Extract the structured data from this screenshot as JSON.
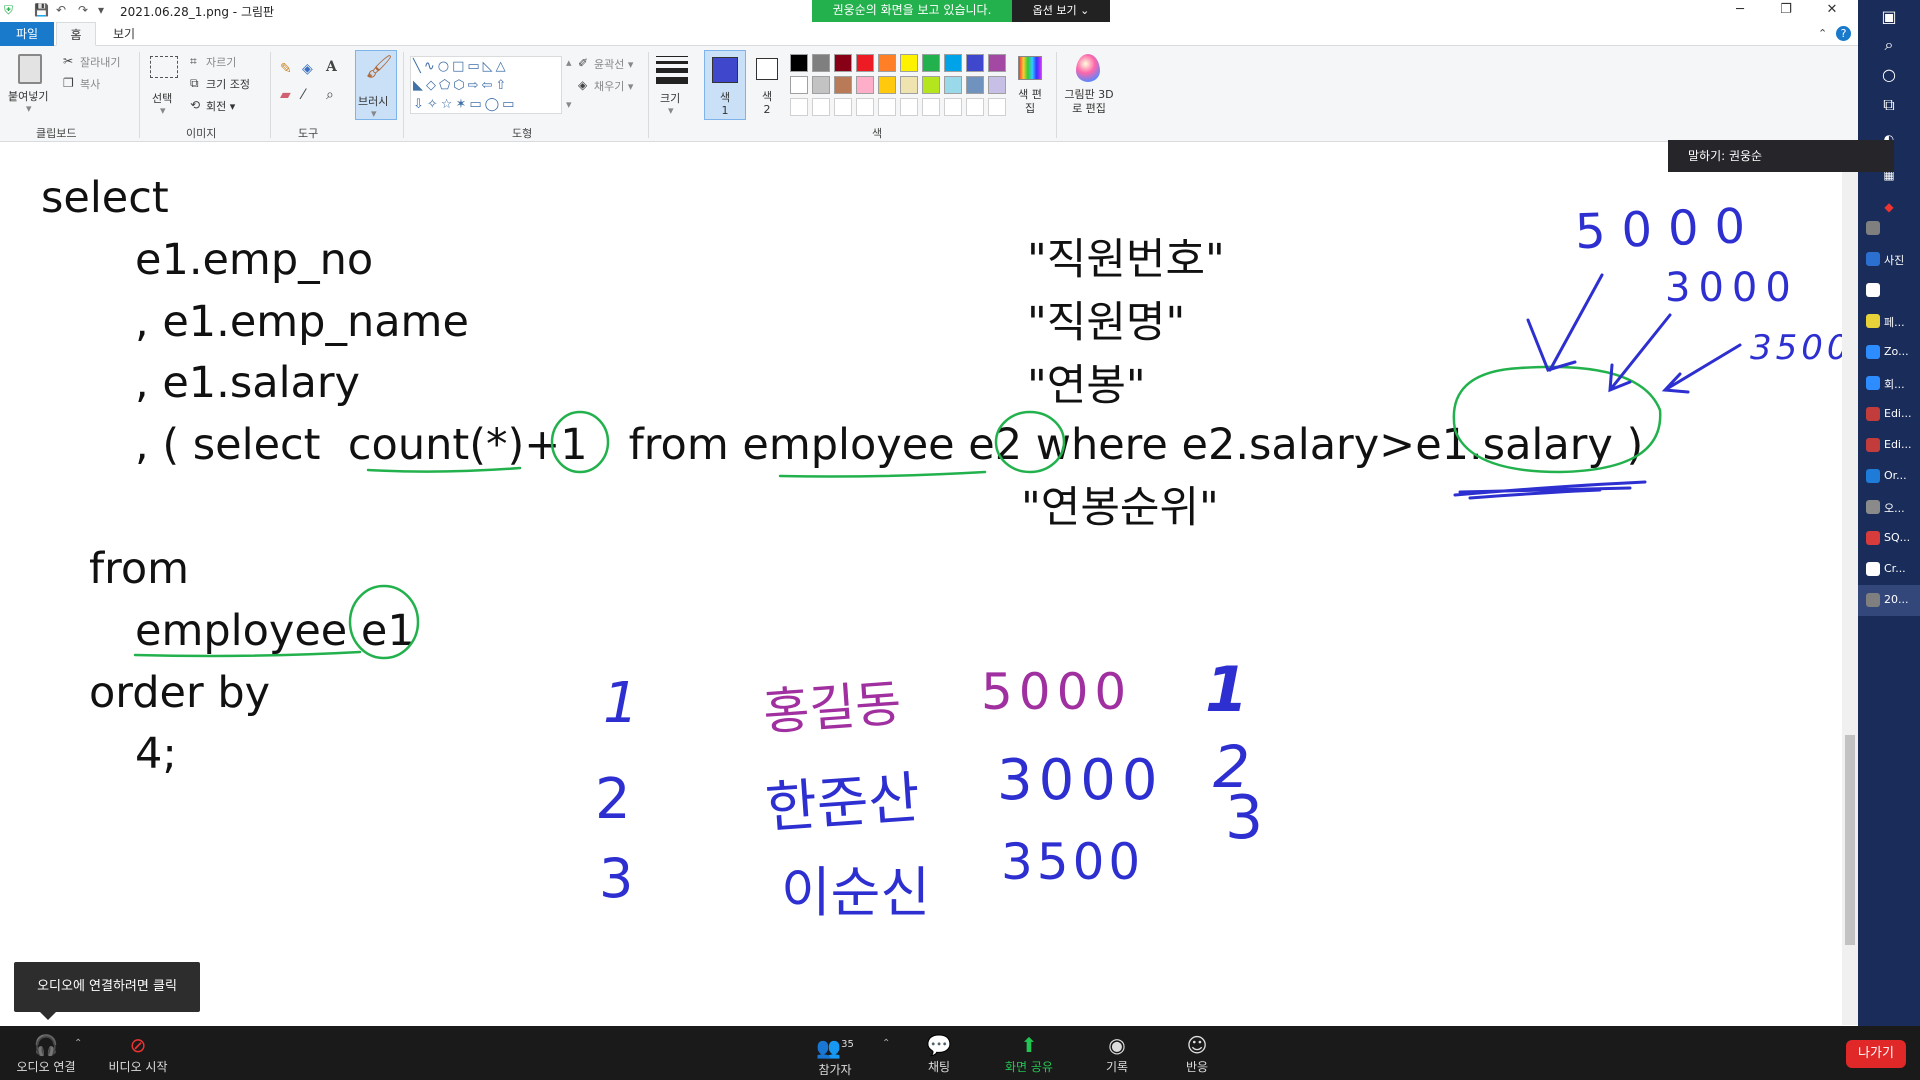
{
  "window": {
    "title": "2021.06.28_1.png - 그림판",
    "minimize": "─",
    "maximize": "❐",
    "close": "✕"
  },
  "share_banner": {
    "text": "권웅순의 화면을 보고 있습니다.",
    "options": "옵션 보기 ⌄"
  },
  "ribbon": {
    "tabs": [
      "파일",
      "홈",
      "보기"
    ],
    "clipboard": {
      "paste": "붙여넣기",
      "cut": "잘라내기",
      "copy": "복사",
      "label": "클립보드"
    },
    "image": {
      "select": "선택",
      "crop": "자르기",
      "resize": "크기 조정",
      "rotate": "회전 ▾",
      "label": "이미지"
    },
    "tools": {
      "label": "도구"
    },
    "brush": {
      "label": "브러시"
    },
    "shapes": {
      "outline": "윤곽선 ▾",
      "fill": "채우기 ▾",
      "label": "도형"
    },
    "size": {
      "label": "크기"
    },
    "color1": {
      "label": "색 1"
    },
    "color2": {
      "label": "색 2"
    },
    "colors": {
      "label": "색",
      "row1": [
        "#000000",
        "#7f7f7f",
        "#880015",
        "#ed1c24",
        "#ff7f27",
        "#fff200",
        "#22b14c",
        "#00a2e8",
        "#3f48cc",
        "#a349a4"
      ],
      "row2": [
        "#ffffff",
        "#c3c3c3",
        "#b97a57",
        "#ffaec9",
        "#ffc90e",
        "#efe4b0",
        "#b5e61d",
        "#99d9ea",
        "#7092be",
        "#c8bfe7"
      ]
    },
    "edit_colors": "색 편집",
    "paint3d": "그림판 3D로 편집"
  },
  "canvas": {
    "code_lines": [
      "select",
      "e1.emp_no",
      ", e1.emp_name",
      ", e1.salary",
      ", ( select  count(*)+1   from employee e2 where e2.salary>e1.salary )",
      "from",
      "employee e1",
      "order by",
      "4;"
    ],
    "aliases": [
      "\"직원번호\"",
      "\"직원명\"",
      "\"연봉\"",
      "\"연봉순위\""
    ],
    "handwriting_top": [
      "5000",
      "3000",
      "3500"
    ],
    "handwriting_table": {
      "ranks": [
        "1",
        "2",
        "3"
      ],
      "names": [
        "홍길동",
        "한준산",
        "이순신"
      ],
      "salaries": [
        "5000",
        "3000",
        "3500"
      ],
      "result_ranks": [
        "1",
        "3",
        "2"
      ]
    },
    "ink_colors": {
      "green": "#22b14c",
      "blue": "#2d2fd0",
      "purple": "#a02fa0"
    }
  },
  "audio_tooltip": "오디오에 연결하려면 클릭",
  "speaking": "말하기: 권웅순",
  "sidebar": {
    "items": [
      {
        "label": "",
        "color": "#7f7f7f"
      },
      {
        "label": "사진",
        "color": "#2b6fd0"
      },
      {
        "label": "",
        "color": "#ffffff"
      },
      {
        "label": "페...",
        "color": "#e8d23a"
      },
      {
        "label": "Zo...",
        "color": "#2d8cff"
      },
      {
        "label": "회...",
        "color": "#2d8cff"
      },
      {
        "label": "Edi...",
        "color": "#c23c3c"
      },
      {
        "label": "Edi...",
        "color": "#c23c3c"
      },
      {
        "label": "Or...",
        "color": "#1e7cd8"
      },
      {
        "label": "오...",
        "color": "#8a8a8a"
      },
      {
        "label": "SQ...",
        "color": "#d83b3b"
      },
      {
        "label": "Cr...",
        "color": "#ffffff"
      },
      {
        "label": "20...",
        "color": "#7f7f7f"
      }
    ]
  },
  "zoom_bar": {
    "audio": "오디오 연결",
    "video": "비디오 시작",
    "participants": "참가자",
    "participants_count": "35",
    "chat": "채팅",
    "share": "화면 공유",
    "record": "기록",
    "reactions": "반응",
    "leave": "나가기"
  }
}
